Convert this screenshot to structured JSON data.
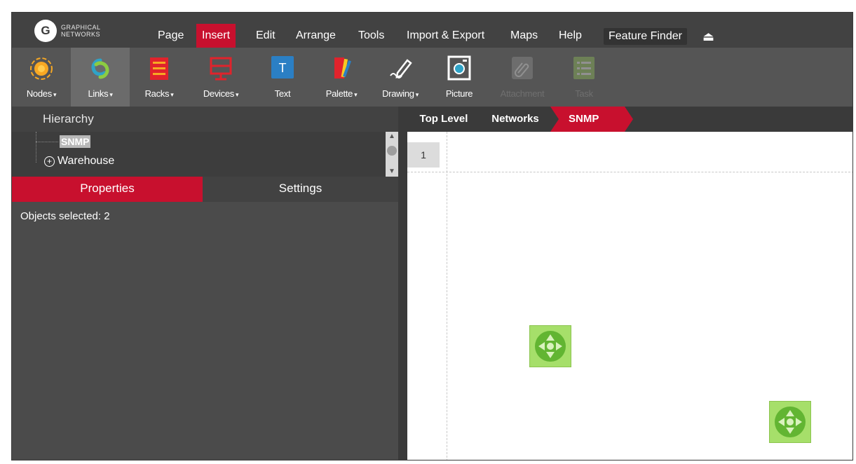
{
  "logo": {
    "mark": "G",
    "line1": "GRAPHICAL",
    "line2": "NETWORKS"
  },
  "menu": {
    "page": "Page",
    "insert": "Insert",
    "edit": "Edit",
    "arrange": "Arrange",
    "tools": "Tools",
    "import_export": "Import & Export",
    "maps": "Maps",
    "help": "Help",
    "feature_finder": "Feature Finder",
    "eject": "⏏"
  },
  "toolbar": {
    "nodes": "Nodes",
    "links": "Links",
    "racks": "Racks",
    "devices": "Devices",
    "text": "Text",
    "palette": "Palette",
    "drawing": "Drawing",
    "picture": "Picture",
    "attachment": "Attachment",
    "task": "Task",
    "caret": "▾"
  },
  "hierarchy": {
    "title": "Hierarchy",
    "items": [
      {
        "label": "SNMP",
        "selected": true
      },
      {
        "label": "Warehouse",
        "expandable": true
      }
    ]
  },
  "tabs": {
    "properties": "Properties",
    "settings": "Settings"
  },
  "properties": {
    "objects_selected": "Objects selected: 2"
  },
  "breadcrumb": {
    "top": "Top Level",
    "networks": "Networks",
    "current": "SNMP"
  },
  "canvas": {
    "page_number": "1"
  },
  "colors": {
    "accent": "#c8102e",
    "node_green": "#a6df6a",
    "node_dark": "#62b532"
  },
  "icons": {
    "nodes": "target-orange-icon",
    "links": "chain-link-icon",
    "racks": "rack-icon",
    "devices": "monitor-icon",
    "text": "text-icon",
    "palette": "palette-icon",
    "drawing": "pencil-icon",
    "picture": "picture-icon",
    "attachment": "paperclip-icon",
    "task": "task-list-icon",
    "node": "move-arrows-icon"
  }
}
